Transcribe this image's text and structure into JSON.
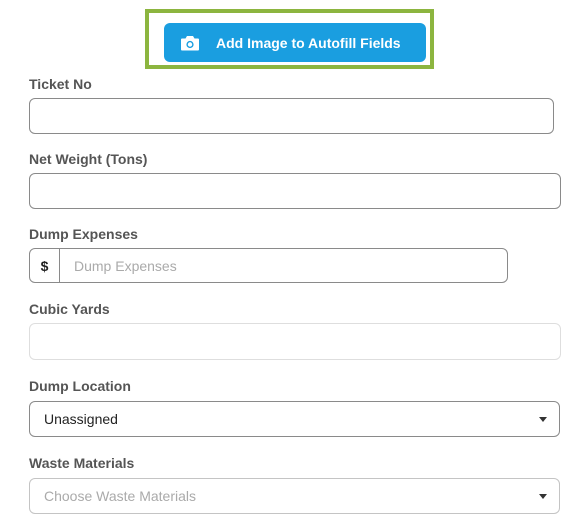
{
  "autofill": {
    "label": "Add Image to Autofill Fields",
    "icon": "camera-icon"
  },
  "fields": {
    "ticket_no": {
      "label": "Ticket No",
      "value": ""
    },
    "net_weight": {
      "label": "Net Weight (Tons)",
      "value": ""
    },
    "dump_expenses": {
      "label": "Dump Expenses",
      "prefix": "$",
      "placeholder": "Dump Expenses"
    },
    "cubic_yards": {
      "label": "Cubic Yards",
      "value": ""
    },
    "dump_location": {
      "label": "Dump Location",
      "value": "Unassigned"
    },
    "waste_materials": {
      "label": "Waste Materials",
      "placeholder": "Choose Waste Materials"
    }
  },
  "colors": {
    "accent": "#1a9ee0",
    "highlight": "#8cb53f"
  }
}
